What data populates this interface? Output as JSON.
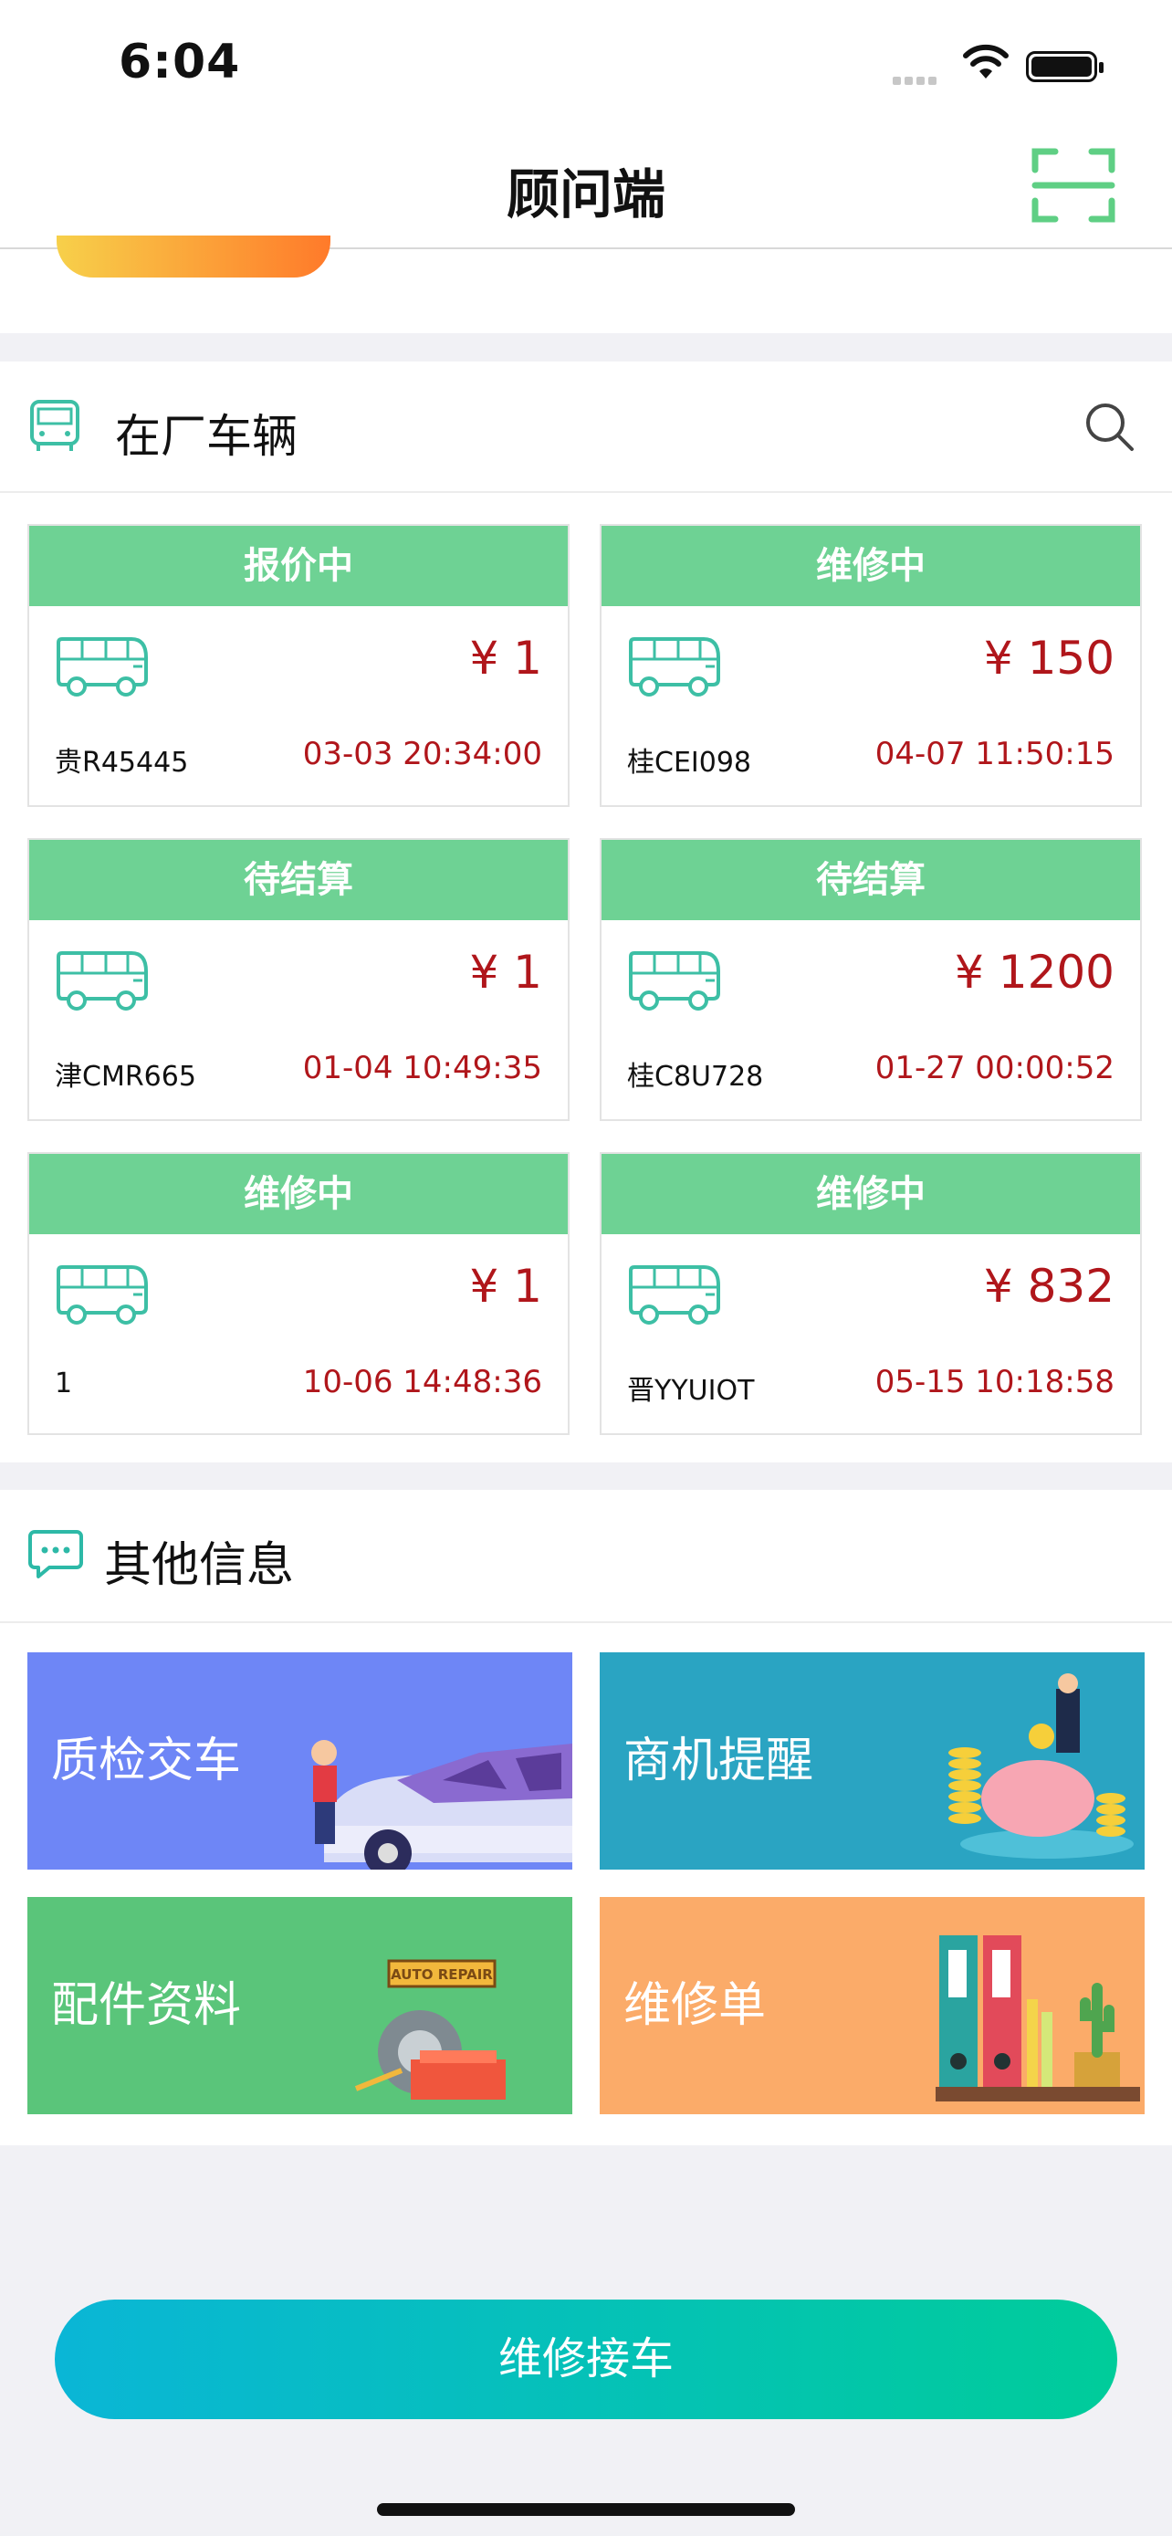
{
  "status_bar": {
    "time": "6:04"
  },
  "nav": {
    "title": "顾问端"
  },
  "vehicles_section": {
    "title": "在厂车辆",
    "cards": [
      {
        "status": "报价中",
        "price": "¥ 1",
        "plate": "贵R45445",
        "time": "03-03 20:34:00"
      },
      {
        "status": "维修中",
        "price": "¥ 150",
        "plate": "桂CEI098",
        "time": "04-07 11:50:15"
      },
      {
        "status": "待结算",
        "price": "¥ 1",
        "plate": "津CMR665",
        "time": "01-04 10:49:35"
      },
      {
        "status": "待结算",
        "price": "¥ 1200",
        "plate": "桂C8U728",
        "time": "01-27 00:00:52"
      },
      {
        "status": "维修中",
        "price": "¥ 1",
        "plate": "1",
        "time": "10-06 14:48:36"
      },
      {
        "status": "维修中",
        "price": "¥ 832",
        "plate": "晋YYUIOT",
        "time": "05-15 10:18:58"
      }
    ]
  },
  "other_section": {
    "title": "其他信息",
    "tiles": [
      {
        "label": "质检交车",
        "color": "#6e86f6"
      },
      {
        "label": "商机提醒",
        "color": "#2aa4c2"
      },
      {
        "label": "配件资料",
        "color": "#5ac57a"
      },
      {
        "label": "维修单",
        "color": "#fbab69"
      }
    ],
    "tile_art": {
      "auto_repair_sign": "AUTO REPAIR"
    }
  },
  "bottom": {
    "primary_button": "维修接车"
  },
  "colors": {
    "accent_green": "#6ed294",
    "price_red": "#b0161b",
    "button_start": "#0ab6d6",
    "button_end": "#00cc9a"
  }
}
